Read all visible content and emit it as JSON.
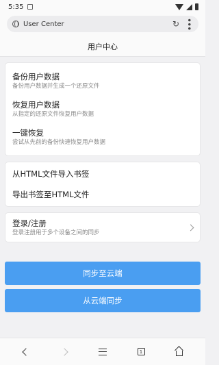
{
  "status_bar": {
    "time": "5:35"
  },
  "browser": {
    "url": "User Center"
  },
  "page": {
    "title": "用户中心"
  },
  "backup_section": {
    "items": [
      {
        "title": "备份用户数据",
        "subtitle": "备份用户数据并生成一个还原文件"
      },
      {
        "title": "恢复用户数据",
        "subtitle": "从指定的还原文件恢复用户数据"
      },
      {
        "title": "一键恢复",
        "subtitle": "尝试从先前的备份快速恢复用户数据"
      }
    ]
  },
  "bookmark_section": {
    "items": [
      {
        "title": "从HTML文件导入书签"
      },
      {
        "title": "导出书签至HTML文件"
      }
    ]
  },
  "account_section": {
    "title": "登录/注册",
    "subtitle": "登录注册用于多个设备之间的同步"
  },
  "buttons": {
    "sync_to_cloud": "同步至云端",
    "sync_from_cloud": "从云端同步"
  },
  "nav": {
    "tab_count": "1"
  },
  "colors": {
    "accent": "#4a9ef1"
  }
}
